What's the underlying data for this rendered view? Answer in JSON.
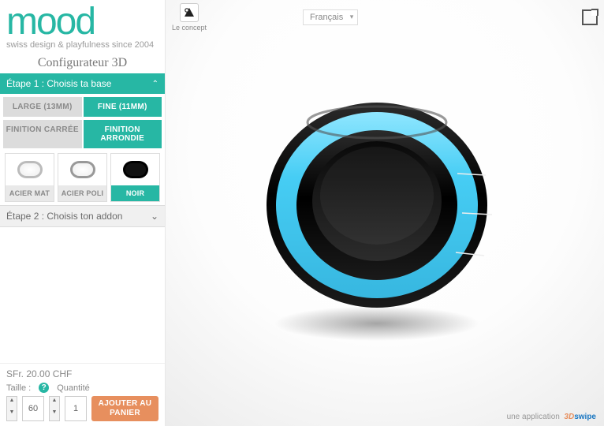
{
  "brand": {
    "logo_text": "mood",
    "tagline": "swiss design & playfulness since 2004"
  },
  "title": "Configurateur 3D",
  "step1": {
    "header": "Étape 1 : Choisis ta base",
    "size_options": {
      "large": "LARGE (13MM)",
      "fine": "FINE (11MM)"
    },
    "finish_options": {
      "carree": "FINITION CARRÉE",
      "arrondie": "FINITION ARRONDIE"
    },
    "materials": {
      "mat": "ACIER MAT",
      "poli": "ACIER POLI",
      "noir": "NOIR"
    }
  },
  "step2": {
    "header": "Étape 2 : Choisis ton addon"
  },
  "footer": {
    "price": "SFr. 20.00 CHF",
    "size_label": "Taille :",
    "qty_label": "Quantité",
    "size_val": "60",
    "qty_val": "1",
    "add_to_cart": "AJOUTER AU PANIER",
    "help_char": "?"
  },
  "topbar": {
    "concept_label": "Le concept",
    "lang_selected": "Français"
  },
  "credit": {
    "prefix": "une application",
    "brand_3d": "3D",
    "brand_swipe": "swipe"
  },
  "icons": {
    "chev_up": "⌃",
    "chev_down": "⌄",
    "tri_up": "▲",
    "tri_down": "▼"
  }
}
